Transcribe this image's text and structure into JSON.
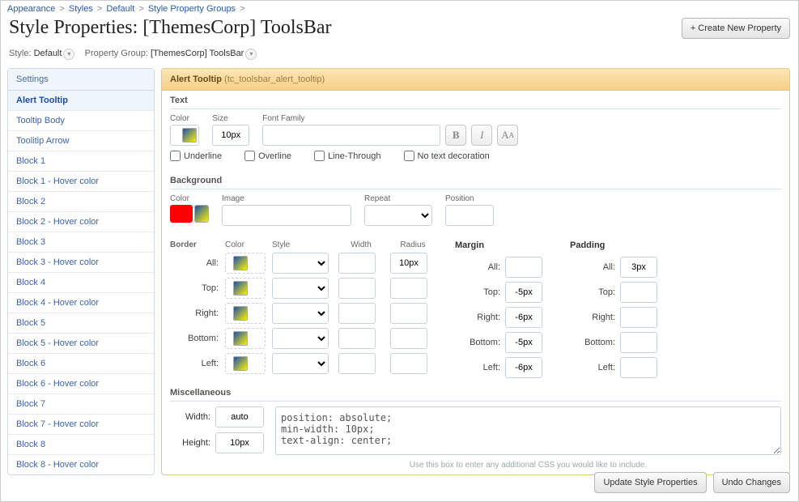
{
  "breadcrumbs": [
    "Appearance",
    "Styles",
    "Default",
    "Style Property Groups"
  ],
  "page_title": "Style Properties: [ThemesCorp] ToolsBar",
  "create_btn": "+ Create New Property",
  "meta": {
    "style_label": "Style:",
    "style_value": "Default",
    "group_label": "Property Group:",
    "group_value": "[ThemesCorp] ToolsBar"
  },
  "sidebar": {
    "heading": "Settings",
    "items": [
      "Alert Tooltip",
      "Tooltip Body",
      "Toolitip Arrow",
      "Block 1",
      "Block 1 - Hover color",
      "Block 2",
      "Block 2 - Hover color",
      "Block 3",
      "Block 3 - Hover color",
      "Block 4",
      "Block 4 - Hover color",
      "Block 5",
      "Block 5 - Hover color",
      "Block 6",
      "Block 6 - Hover color",
      "Block 7",
      "Block 7 - Hover color",
      "Block 8",
      "Block 8 - Hover color"
    ],
    "active": 0
  },
  "panel": {
    "title": "Alert Tooltip",
    "id": "(tc_toolsbar_alert_tooltip)"
  },
  "text": {
    "heading": "Text",
    "color_lbl": "Color",
    "size_lbl": "Size",
    "size_val": "10px",
    "ff_lbl": "Font Family",
    "ff_val": "",
    "deco": {
      "underline": "Underline",
      "overline": "Overline",
      "linethrough": "Line-Through",
      "none": "No text decoration"
    }
  },
  "bg": {
    "heading": "Background",
    "color_lbl": "Color",
    "image_lbl": "Image",
    "image_val": "",
    "repeat_lbl": "Repeat",
    "position_lbl": "Position",
    "position_val": ""
  },
  "border": {
    "heading": "Border",
    "color_h": "Color",
    "style_h": "Style",
    "width_h": "Width",
    "radius_h": "Radius",
    "rows": [
      {
        "lbl": "All:",
        "width": "",
        "radius": "10px"
      },
      {
        "lbl": "Top:",
        "width": "",
        "radius": ""
      },
      {
        "lbl": "Right:",
        "width": "",
        "radius": ""
      },
      {
        "lbl": "Bottom:",
        "width": "",
        "radius": ""
      },
      {
        "lbl": "Left:",
        "width": "",
        "radius": ""
      }
    ]
  },
  "margin": {
    "heading": "Margin",
    "rows": [
      {
        "lbl": "All:",
        "val": ""
      },
      {
        "lbl": "Top:",
        "val": "-5px"
      },
      {
        "lbl": "Right:",
        "val": "-6px"
      },
      {
        "lbl": "Bottom:",
        "val": "-5px"
      },
      {
        "lbl": "Left:",
        "val": "-6px"
      }
    ]
  },
  "padding": {
    "heading": "Padding",
    "rows": [
      {
        "lbl": "All:",
        "val": "3px"
      },
      {
        "lbl": "Top:",
        "val": ""
      },
      {
        "lbl": "Right:",
        "val": ""
      },
      {
        "lbl": "Bottom:",
        "val": ""
      },
      {
        "lbl": "Left:",
        "val": ""
      }
    ]
  },
  "misc": {
    "heading": "Miscellaneous",
    "width_lbl": "Width:",
    "width_val": "auto",
    "height_lbl": "Height:",
    "height_val": "10px",
    "css": "position: absolute;\nmin-width: 10px;\ntext-align: center;",
    "hint": "Use this box to enter any additional CSS you would like to include."
  },
  "footer": {
    "update": "Update Style Properties",
    "undo": "Undo Changes"
  }
}
